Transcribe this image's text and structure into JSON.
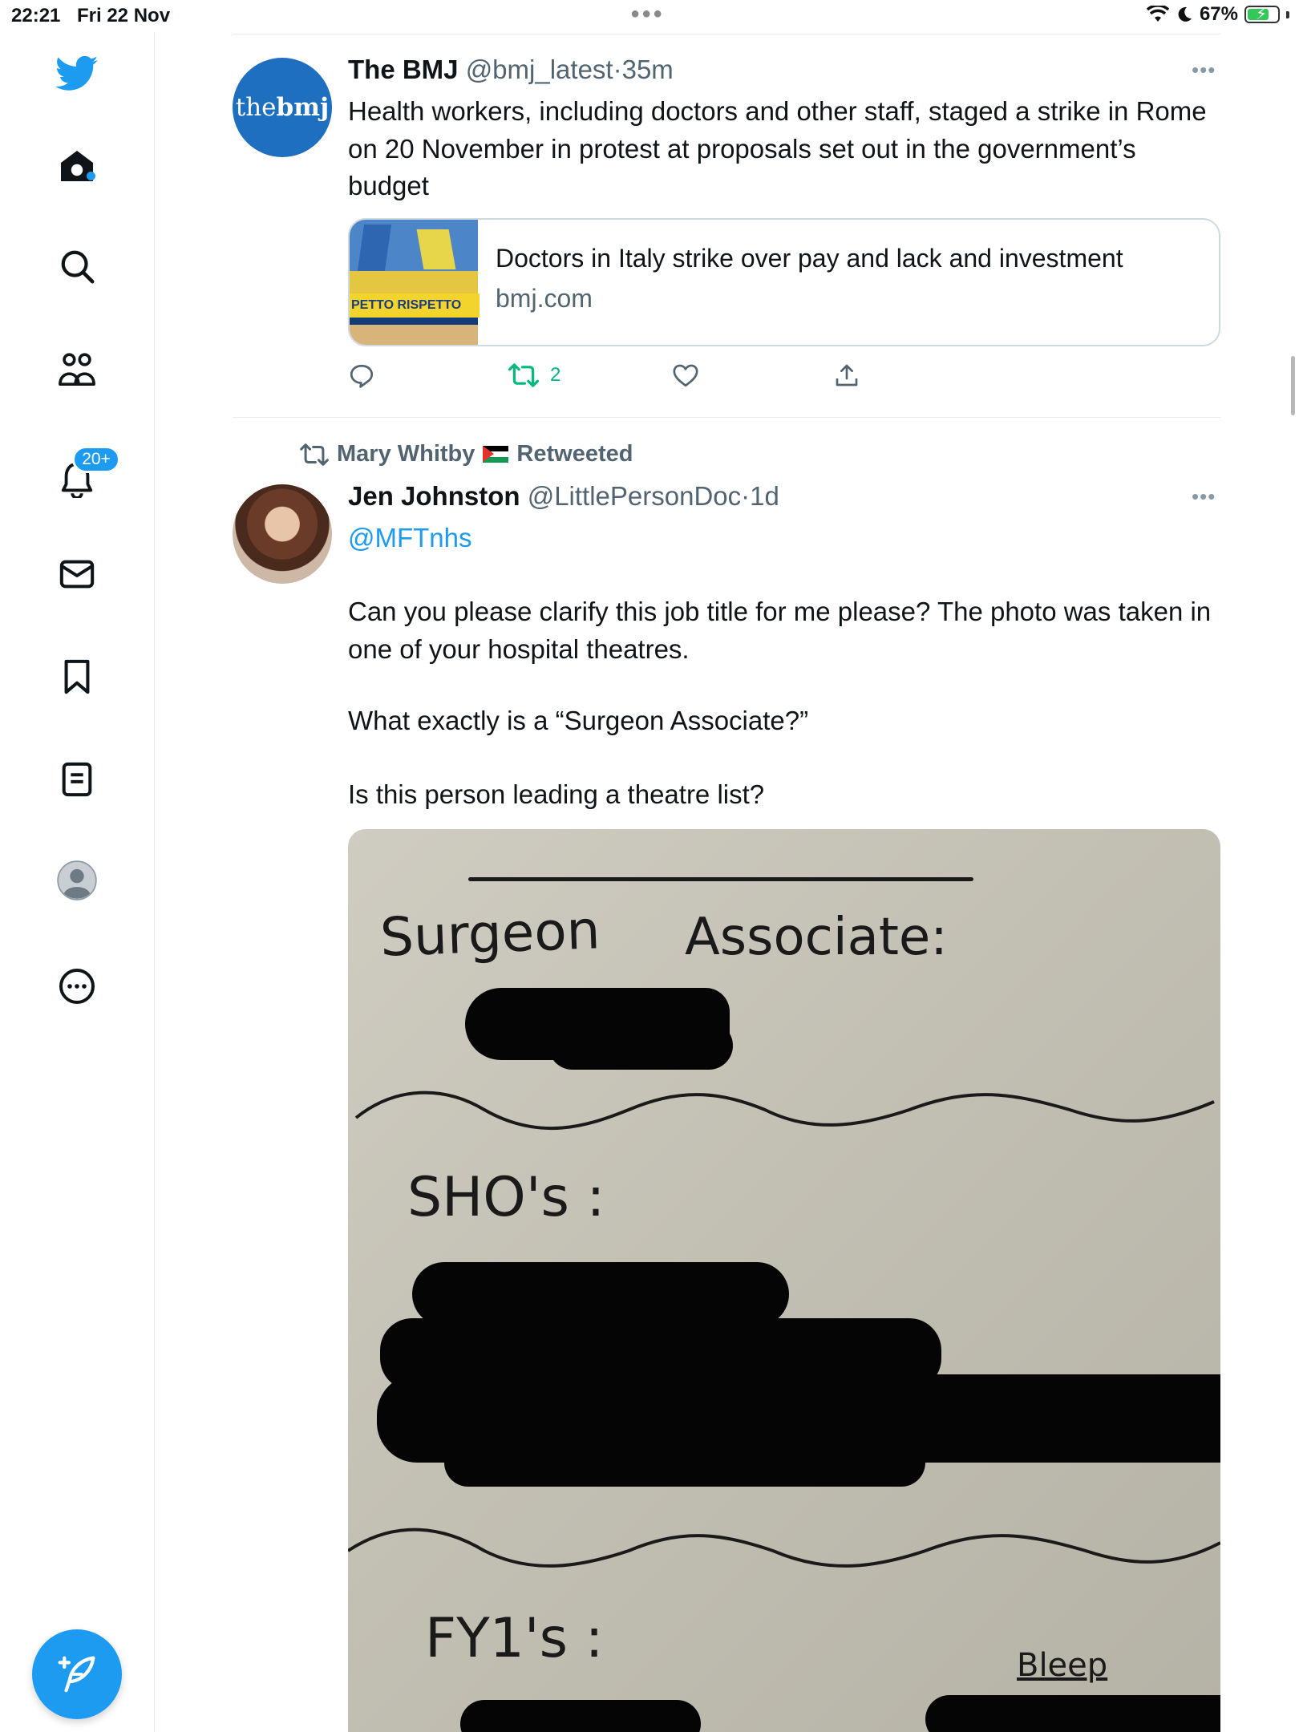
{
  "status_bar": {
    "time": "22:21",
    "date": "Fri 22 Nov",
    "battery_percent": "67%",
    "battery_level": 0.67
  },
  "sidebar": {
    "items": [
      {
        "name": "twitter-logo",
        "icon": "twitter-bird-icon"
      },
      {
        "name": "home",
        "icon": "home-icon"
      },
      {
        "name": "explore",
        "icon": "search-icon"
      },
      {
        "name": "communities",
        "icon": "communities-icon"
      },
      {
        "name": "notifications",
        "icon": "bell-icon"
      },
      {
        "name": "messages",
        "icon": "envelope-icon"
      },
      {
        "name": "bookmarks",
        "icon": "bookmark-icon"
      },
      {
        "name": "lists",
        "icon": "list-icon"
      },
      {
        "name": "profile",
        "icon": "profile-icon"
      },
      {
        "name": "more",
        "icon": "more-circle-icon"
      }
    ],
    "notification_badge": "20+",
    "compose_icon": "compose-feather-icon"
  },
  "colors": {
    "accent": "#1d9bf0",
    "retweet_green": "#00ba7c",
    "secondary_text": "#536471"
  },
  "tweets": [
    {
      "avatar_text_light": "the",
      "avatar_text_bold": "bmj",
      "author": "The BMJ",
      "handle": "@bmj_latest",
      "separator": "·",
      "time": "35m",
      "text": "Health workers, including doctors and other staff, staged a strike in Rome on 20 November in protest at proposals set out in the government’s budget",
      "card": {
        "title": "Doctors in Italy strike over pay and lack and investment",
        "domain": "bmj.com",
        "thumb_banner": "PETTO RISPETTO"
      },
      "actions": {
        "reply_count": "",
        "retweet_count": "2",
        "like_count": ""
      }
    },
    {
      "retweeted_by": "Mary Whitby",
      "retweeted_label": "Retweeted",
      "author": "Jen Johnston",
      "handle": "@LittlePersonDoc",
      "separator": "·",
      "time": "1d",
      "mention": "@MFTnhs",
      "paragraphs": [
        "Can you please clarify this job title for me please? The photo was taken in one of your hospital theatres.",
        "What exactly is a “Surgeon Associate?”",
        "Is this person leading a theatre list?"
      ],
      "photo_text": {
        "line1": "Surgeon",
        "line1b": "Associate:",
        "line2": "SHO's :",
        "line3": "FY1's :",
        "note": "Bleep"
      }
    }
  ]
}
